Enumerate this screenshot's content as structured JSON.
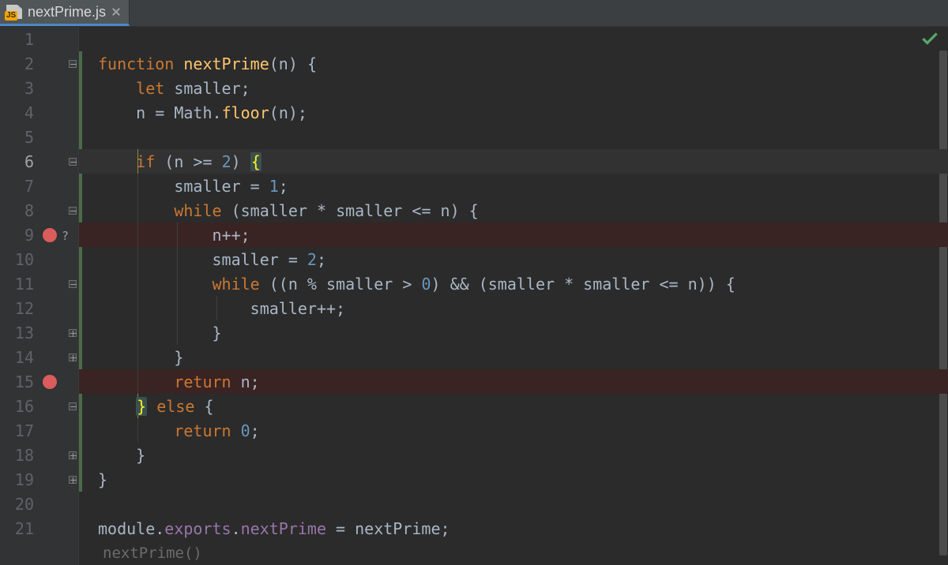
{
  "tab": {
    "filename": "nextPrime.js"
  },
  "gutter": {
    "numbers": [
      "1",
      "2",
      "3",
      "4",
      "5",
      "6",
      "7",
      "8",
      "9",
      "10",
      "11",
      "12",
      "13",
      "14",
      "15",
      "16",
      "17",
      "18",
      "19",
      "20",
      "21"
    ]
  },
  "breakpoints": {
    "line9_question": "?",
    "lines": [
      9,
      15
    ]
  },
  "hint": {
    "text": "nextPrime()"
  },
  "code": {
    "l2": {
      "kw": "function",
      "name": "nextPrime",
      "args_open": "(",
      "arg": "n",
      "args_close": ")",
      "brace": "{"
    },
    "l3": {
      "kw": "let",
      "id": "smaller",
      "semi": ";"
    },
    "l4": {
      "lhs": "n",
      "eq": " = ",
      "obj": "Math",
      "dot": ".",
      "fn": "floor",
      "open": "(",
      "arg": "n",
      "close": ")",
      "semi": ";"
    },
    "l6": {
      "kw": "if",
      "open": " (",
      "lhs": "n",
      "op": " >= ",
      "num": "2",
      "close": ") ",
      "brace": "{"
    },
    "l7": {
      "id": "smaller",
      "eq": " = ",
      "num": "1",
      "semi": ";"
    },
    "l8": {
      "kw": "while",
      "open": " (",
      "a": "smaller",
      "op1": " * ",
      "b": "smaller",
      "op2": " <= ",
      "c": "n",
      "close": ") {",
      "brace": ""
    },
    "l9": {
      "id": "n",
      "op": "++",
      "semi": ";"
    },
    "l10": {
      "id": "smaller",
      "eq": " = ",
      "num": "2",
      "semi": ";"
    },
    "l11": {
      "kw": "while",
      "open": " ((",
      "a": "n",
      "op1": " % ",
      "b": "smaller",
      "op2": " > ",
      "num": "0",
      "mid": ") && (",
      "c": "smaller",
      "op3": " * ",
      "d": "smaller",
      "op4": " <= ",
      "e": "n",
      "close": ")) {"
    },
    "l12": {
      "id": "smaller",
      "op": "++",
      "semi": ";"
    },
    "l13": {
      "brace": "}"
    },
    "l14": {
      "brace": "}"
    },
    "l15": {
      "kw": "return",
      "sp": " ",
      "id": "n",
      "semi": ";"
    },
    "l16": {
      "close": "}",
      "sp": " ",
      "kw": "else",
      "sp2": " ",
      "open": "{"
    },
    "l17": {
      "kw": "return",
      "sp": " ",
      "num": "0",
      "semi": ";"
    },
    "l18": {
      "brace": "}"
    },
    "l19": {
      "brace": "}"
    },
    "l21": {
      "obj": "module",
      "dot1": ".",
      "p1": "exports",
      "dot2": ".",
      "p2": "nextPrime",
      "eq": " = ",
      "rhs": "nextPrime",
      "semi": ";"
    }
  }
}
